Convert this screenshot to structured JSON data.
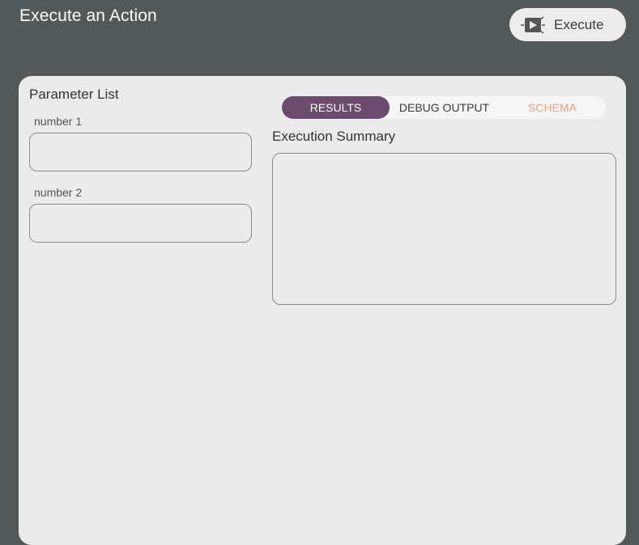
{
  "header": {
    "title": "Execute an Action",
    "execute_label": "Execute",
    "execute_icon": "play-script-icon"
  },
  "parameters": {
    "title": "Parameter List",
    "fields": [
      {
        "label": "number 1",
        "value": ""
      },
      {
        "label": "number 2",
        "value": ""
      }
    ]
  },
  "results": {
    "tabs": [
      {
        "label": "RESULTS",
        "active": true
      },
      {
        "label": "DEBUG OUTPUT",
        "active": false
      },
      {
        "label": "SCHEMA",
        "active": false
      }
    ],
    "summary_title": "Execution Summary",
    "summary_text": ""
  },
  "colors": {
    "background": "#525958",
    "panel": "#ebebeb",
    "active_tab": "#6b4c6c",
    "schema_tab": "#f0a27a"
  }
}
